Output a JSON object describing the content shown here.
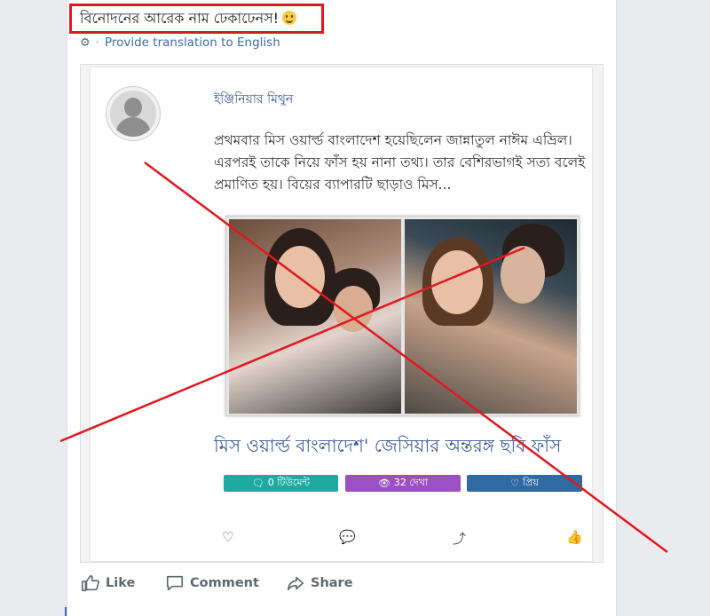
{
  "post": {
    "text": "বিনোদনের আরেক নাম ঢেকাঢেনস!",
    "emoji": "slightly-smiling-face",
    "translate_label": "Provide translation to English"
  },
  "shared": {
    "author": "ইঞ্জিনিয়ার মিথুন",
    "excerpt": "প্রথমবার মিস ওয়ার্ল্ড বাংলাদেশ হয়েছিলেন জান্নাতুল নাঈম এভ্রিল। এরপরই তাকে নিয়ে ফাঁস হয় নানা তথ্য। তার বেশিরভাগই সত্য বলেই প্রমাণিত হয়। বিয়ের ব্যাপারটি ছাড়াও মিস...",
    "headline": "মিস ওয়ার্ল্ড বাংলাদেশ' জেসিয়ার অন্তরঙ্গ ছবি ফাঁস",
    "badges": {
      "comments": "0 টিউমেন্ট",
      "views": "32 দেখা",
      "fav": "প্রিয়"
    },
    "mini_icons": [
      "heart-icon",
      "speech-bubble-icon",
      "share-box-icon",
      "thumbs-up-icon"
    ]
  },
  "actions": {
    "like": "Like",
    "comment": "Comment",
    "share": "Share"
  },
  "colors": {
    "annotation_red": "#e0181f",
    "link_blue": "#4267b2",
    "action_gray": "#606770"
  }
}
